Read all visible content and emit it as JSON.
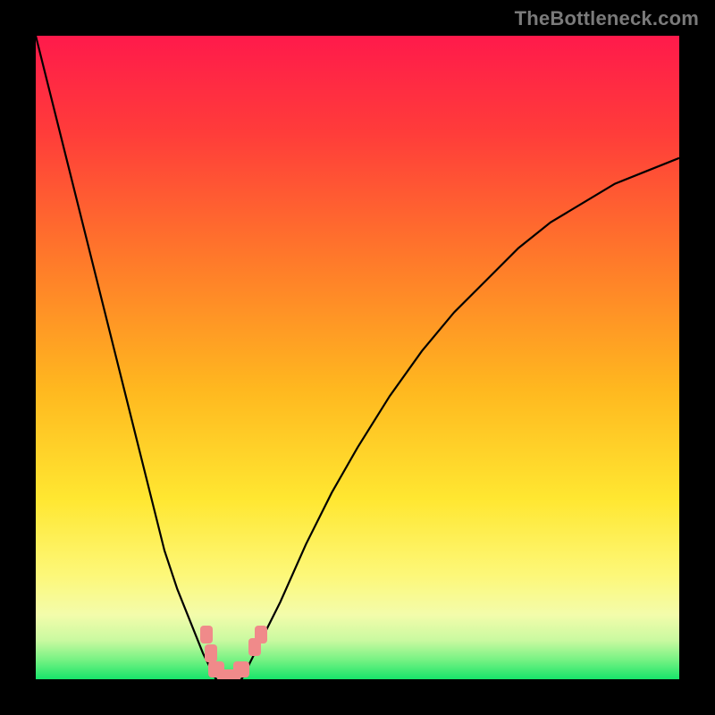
{
  "watermark": "TheBottleneck.com",
  "colors": {
    "page_bg": "#000000",
    "curve": "#000000",
    "marker": "#f08a8a",
    "watermark_text": "#7a7a7a"
  },
  "chart_data": {
    "type": "line",
    "title": "",
    "xlabel": "",
    "ylabel": "",
    "xlim": [
      0,
      100
    ],
    "ylim": [
      0,
      100
    ],
    "x": [
      0,
      2,
      4,
      6,
      8,
      10,
      12,
      14,
      16,
      18,
      20,
      22,
      24,
      26,
      27,
      28,
      29,
      30,
      31,
      32,
      33,
      35,
      38,
      42,
      46,
      50,
      55,
      60,
      65,
      70,
      75,
      80,
      85,
      90,
      95,
      100
    ],
    "values": [
      100,
      92,
      84,
      76,
      68,
      60,
      52,
      44,
      36,
      28,
      20,
      14,
      9,
      4,
      2,
      0,
      0,
      0,
      0,
      0,
      2,
      6,
      12,
      21,
      29,
      36,
      44,
      51,
      57,
      62,
      67,
      71,
      74,
      77,
      79,
      81
    ],
    "optimal_x": 29,
    "gradient_stops": [
      {
        "pct": 0,
        "color": "#ff1a4b"
      },
      {
        "pct": 15,
        "color": "#ff3c3a"
      },
      {
        "pct": 35,
        "color": "#ff7a2a"
      },
      {
        "pct": 55,
        "color": "#ffb81f"
      },
      {
        "pct": 72,
        "color": "#ffe731"
      },
      {
        "pct": 84,
        "color": "#fdf87a"
      },
      {
        "pct": 90,
        "color": "#f3fcab"
      },
      {
        "pct": 94,
        "color": "#c9f9a0"
      },
      {
        "pct": 97,
        "color": "#76f283"
      },
      {
        "pct": 100,
        "color": "#17e56a"
      }
    ],
    "markers": [
      {
        "x": 26.5,
        "y": 7,
        "w": 14,
        "h": 20
      },
      {
        "x": 27.2,
        "y": 4,
        "w": 14,
        "h": 20
      },
      {
        "x": 28.0,
        "y": 1.5,
        "w": 18,
        "h": 18
      },
      {
        "x": 30.0,
        "y": 0.5,
        "w": 26,
        "h": 14
      },
      {
        "x": 32.0,
        "y": 1.5,
        "w": 18,
        "h": 18
      },
      {
        "x": 34.0,
        "y": 5,
        "w": 14,
        "h": 20
      },
      {
        "x": 35.0,
        "y": 7,
        "w": 14,
        "h": 20
      }
    ]
  }
}
